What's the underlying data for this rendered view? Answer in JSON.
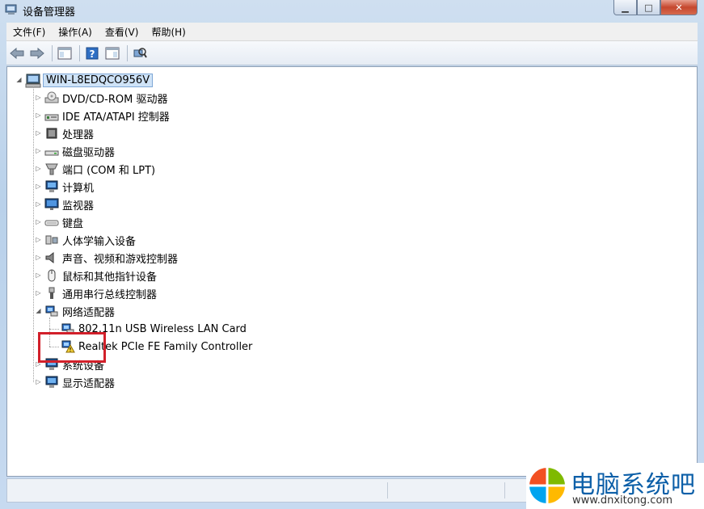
{
  "window": {
    "title": "设备管理器"
  },
  "menu": [
    "文件(F)",
    "操作(A)",
    "查看(V)",
    "帮助(H)"
  ],
  "toolbar": {
    "icons": [
      "back-icon",
      "forward-icon",
      "show-hide-console-tree-icon",
      "help-icon",
      "properties-icon",
      "scan-hardware-icon"
    ]
  },
  "tree": {
    "root": "WIN-L8EDQCO956V",
    "categories": [
      {
        "label": "DVD/CD-ROM 驱动器",
        "icon": "dvd-icon"
      },
      {
        "label": "IDE ATA/ATAPI 控制器",
        "icon": "ide-controller-icon"
      },
      {
        "label": "处理器",
        "icon": "processor-icon"
      },
      {
        "label": "磁盘驱动器",
        "icon": "disk-drive-icon"
      },
      {
        "label": "端口 (COM 和 LPT)",
        "icon": "port-icon"
      },
      {
        "label": "计算机",
        "icon": "computer-icon"
      },
      {
        "label": "监视器",
        "icon": "monitor-icon"
      },
      {
        "label": "键盘",
        "icon": "keyboard-icon"
      },
      {
        "label": "人体学输入设备",
        "icon": "hid-icon"
      },
      {
        "label": "声音、视频和游戏控制器",
        "icon": "sound-icon"
      },
      {
        "label": "鼠标和其他指针设备",
        "icon": "mouse-icon"
      },
      {
        "label": "通用串行总线控制器",
        "icon": "usb-icon"
      },
      {
        "label": "网络适配器",
        "icon": "network-adapter-icon"
      }
    ],
    "network_children": [
      {
        "label": "802.11n USB Wireless LAN Card",
        "icon": "network-adapter-icon",
        "warning": false
      },
      {
        "label": "Realtek PCIe FE Family Controller",
        "icon": "network-adapter-warning-icon",
        "warning": true
      }
    ],
    "after": [
      {
        "label": "系统设备",
        "icon": "system-device-icon"
      },
      {
        "label": "显示适配器",
        "icon": "display-adapter-icon"
      }
    ]
  },
  "watermark": {
    "title": "电脑系统吧",
    "url": "www.dnxitong.com"
  },
  "colors": {
    "highlight": "#d2202a",
    "accent": "#0c5fa8"
  }
}
